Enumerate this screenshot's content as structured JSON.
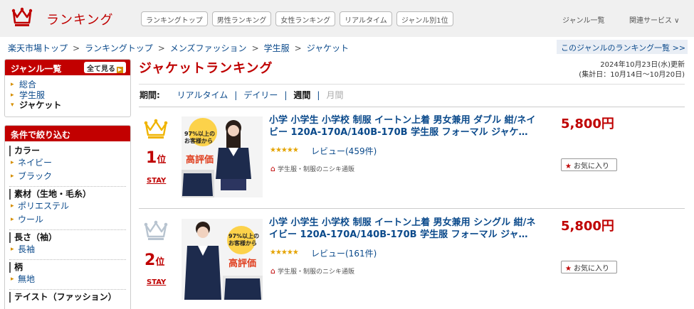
{
  "header": {
    "logo_text": "ランキング",
    "nav": [
      "ランキングトップ",
      "男性ランキング",
      "女性ランキング",
      "リアルタイム",
      "ジャンル別1位"
    ],
    "genre_list": "ジャンル一覧",
    "related_services": "関連サービス ∨"
  },
  "breadcrumb": [
    "楽天市場トップ",
    "ランキングトップ",
    "メンズファッション",
    "学生服",
    "ジャケット"
  ],
  "genre_ranking_link": "このジャンルのランキング一覧 >>",
  "sidebar": {
    "genre_title": "ジャンル一覧",
    "show_all": "全て見る",
    "genres": [
      "総合",
      "学生服",
      "ジャケット"
    ],
    "filter_title": "条件で絞り込む",
    "filters": [
      {
        "head": "カラー",
        "options": [
          "ネイビー",
          "ブラック"
        ]
      },
      {
        "head": "素材（生地・毛糸）",
        "options": [
          "ポリエステル",
          "ウール"
        ]
      },
      {
        "head": "長さ（袖）",
        "options": [
          "長袖"
        ]
      },
      {
        "head": "柄",
        "options": [
          "無地"
        ]
      },
      {
        "head": "テイスト（ファッション）",
        "options": []
      }
    ]
  },
  "main": {
    "title": "ジャケットランキング",
    "updated": "2024年10月23日(水)更新",
    "period_range": "(集計日：10月14日～10月20日)",
    "period_label": "期間:",
    "periods": {
      "realtime": "リアルタイム",
      "daily": "デイリー",
      "weekly": "週間",
      "monthly": "月間"
    }
  },
  "products": [
    {
      "rank": "1",
      "rank_suffix": "位",
      "status": "STAY",
      "title": "小学 小学生 小学校 制服 イートン上着 男女兼用 ダブル 紺/ネイビー 120A-170A/140B-170B 学生服 フォーマル ジャケ…",
      "stars": "★★★★★",
      "review": "レビュー(459件)",
      "shop": "学生服・制服のニシキ通販",
      "price": "5,800円",
      "fav": "お気に入り",
      "thumb_text": [
        "97%以上の",
        "お客様から",
        "高評価"
      ]
    },
    {
      "rank": "2",
      "rank_suffix": "位",
      "status": "STAY",
      "title": "小学 小学生 小学校 制服 イートン上着 男女兼用 シングル 紺/ネイビー 120A-170A/140B-170B 学生服 フォーマル ジャ…",
      "stars": "★★★★★",
      "review": "レビュー(161件)",
      "shop": "学生服・制服のニシキ通販",
      "price": "5,800円",
      "fav": "お気に入り",
      "thumb_text": [
        "97%以上の",
        "お客様から",
        "高評価"
      ]
    }
  ],
  "colors": {
    "accent": "#bf0000",
    "link": "#0b4a8b",
    "gold": "#f0b400",
    "silver": "#b8c4d0"
  }
}
